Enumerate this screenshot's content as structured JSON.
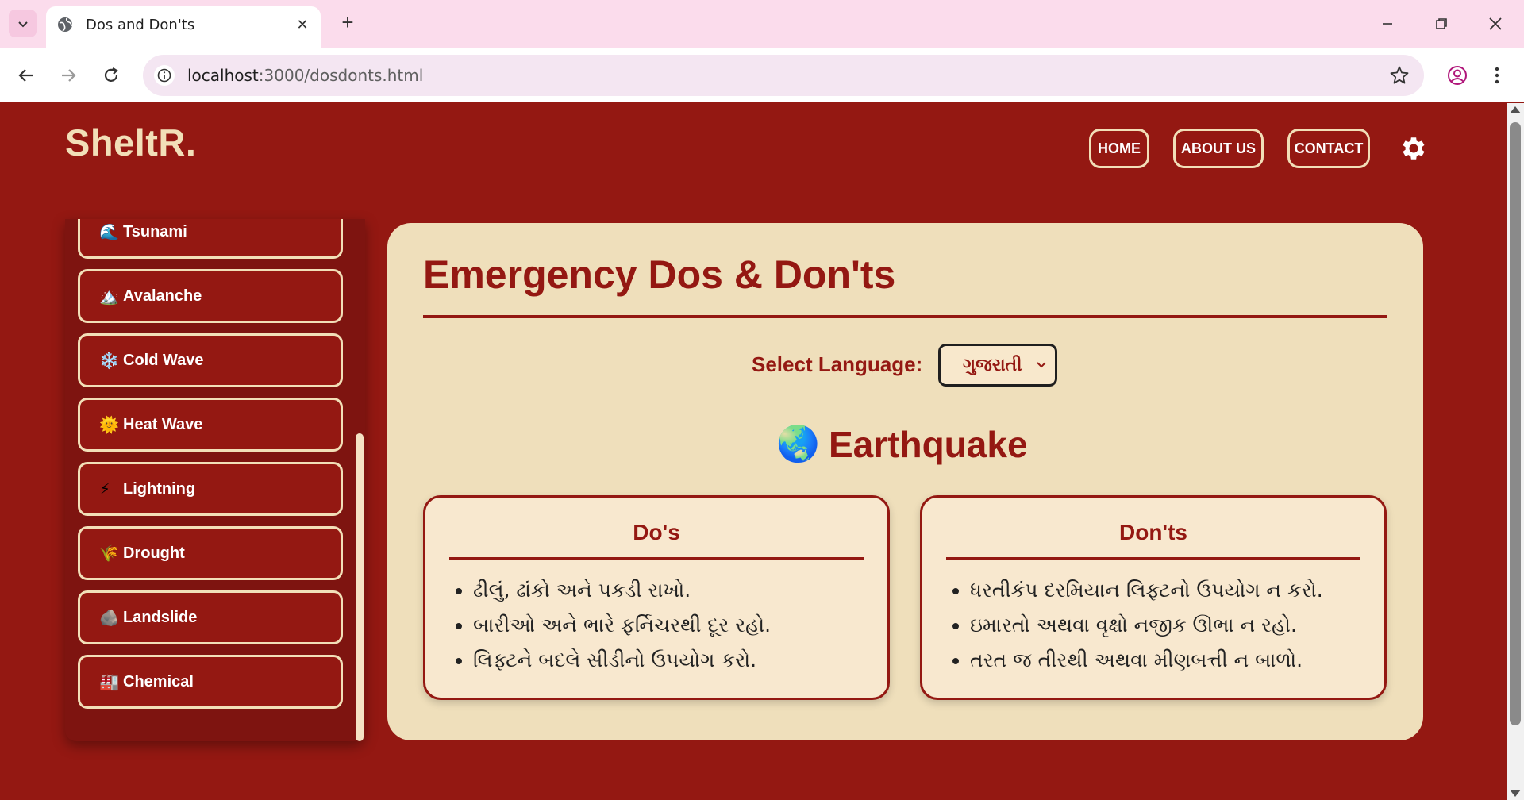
{
  "browser": {
    "tab_title": "Dos and Don'ts",
    "url_host": "localhost",
    "url_path": ":3000/dosdonts.html"
  },
  "site": {
    "logo": "SheltR.",
    "nav": [
      {
        "label": "HOME"
      },
      {
        "label": "ABOUT US"
      },
      {
        "label": "CONTACT"
      }
    ]
  },
  "sidebar": {
    "items": [
      {
        "emoji": "🌊",
        "label": "Tsunami"
      },
      {
        "emoji": "🏔️",
        "label": "Avalanche"
      },
      {
        "emoji": "❄️",
        "label": "Cold Wave"
      },
      {
        "emoji": "🌞",
        "label": "Heat Wave"
      },
      {
        "emoji": "⚡",
        "label": "Lightning"
      },
      {
        "emoji": "🌾",
        "label": "Drought"
      },
      {
        "emoji": "🪨",
        "label": "Landslide"
      },
      {
        "emoji": "🏭",
        "label": "Chemical"
      }
    ]
  },
  "main": {
    "title": "Emergency Dos & Don'ts",
    "language_label": "Select Language:",
    "language_selected": "ગુજરાતી",
    "disaster_emoji": "🌏",
    "disaster_title": "Earthquake",
    "dos": {
      "title": "Do's",
      "items": [
        "ઢીલું, ઢાંકો અને પકડી રાખો.",
        "બારીઓ અને ભારે ફર્નિચરથી દૂર રહો.",
        "લિફ્ટને બદલે સીડીનો ઉપયોગ કરો."
      ]
    },
    "donts": {
      "title": "Don'ts",
      "items": [
        "ધરતીકંપ દરમિયાન લિફ્ટનો ઉપયોગ ન કરો.",
        "ઇમારતો અથવા વૃક્ષો નજીક ઊભા ન રહો.",
        "તરત જ તીરથી અથવા મીણબત્તી ન બાળો."
      ]
    }
  },
  "colors": {
    "brand_red": "#941812",
    "cream": "#efdfbb",
    "tab_strip": "#fbdcec"
  }
}
